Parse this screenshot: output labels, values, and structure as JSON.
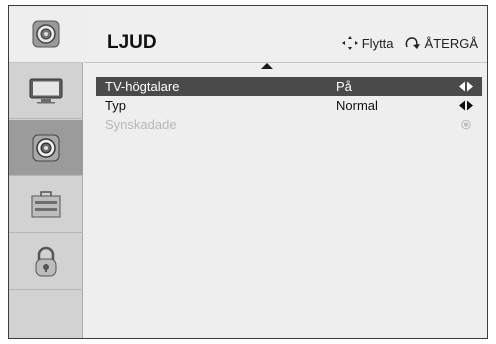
{
  "header": {
    "title": "LJUD",
    "move_label": "Flytta",
    "back_label": "ÅTERGÅ"
  },
  "sidebar": {
    "items": [
      {
        "icon": "speaker-icon",
        "selected": false
      },
      {
        "icon": "tv-icon",
        "selected": false
      },
      {
        "icon": "speaker-icon",
        "selected": true
      },
      {
        "icon": "toolbox-icon",
        "selected": false
      },
      {
        "icon": "lock-icon",
        "selected": false
      }
    ]
  },
  "menu": {
    "rows": [
      {
        "label": "TV-högtalare",
        "value": "På",
        "selected": true,
        "enabled": true,
        "indicator": "left-right-arrows"
      },
      {
        "label": "Typ",
        "value": "Normal",
        "selected": false,
        "enabled": true,
        "indicator": "left-right-arrows"
      },
      {
        "label": "Synskadade",
        "value": "",
        "selected": false,
        "enabled": false,
        "indicator": "radio"
      }
    ]
  }
}
